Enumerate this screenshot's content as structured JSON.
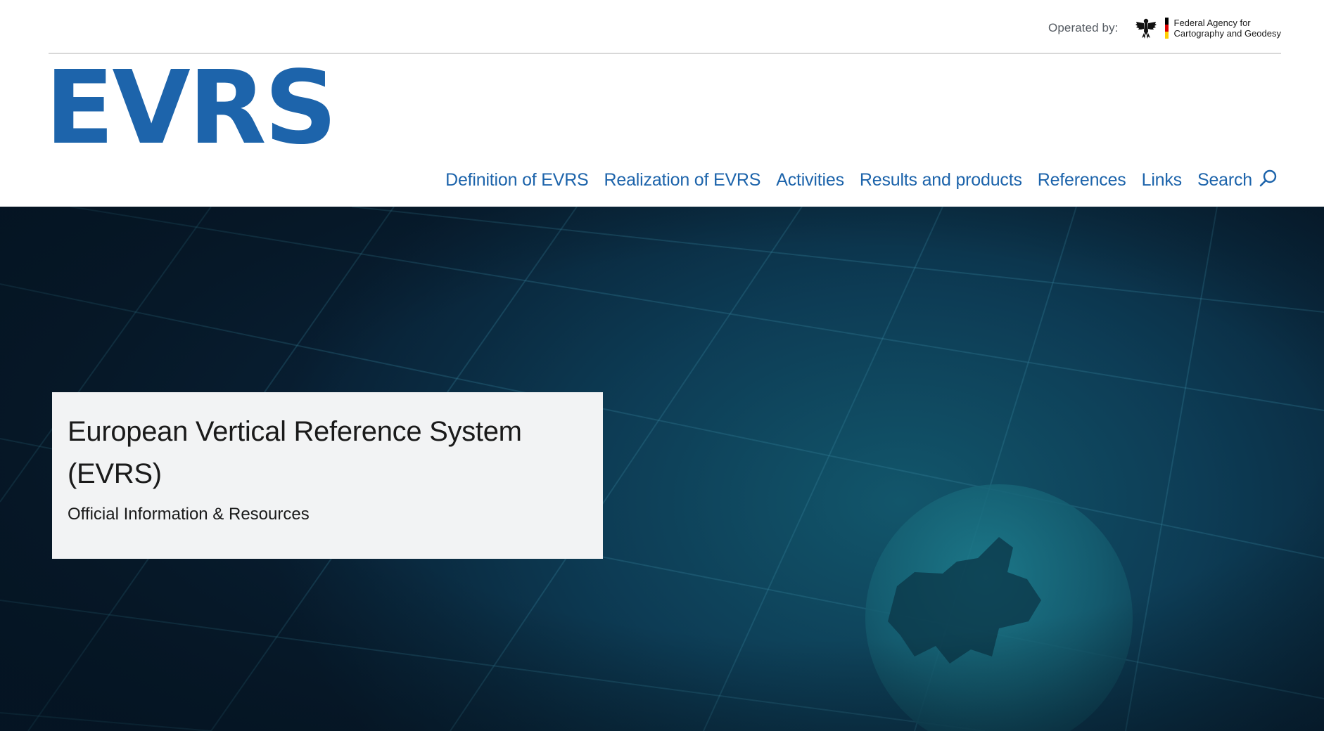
{
  "header": {
    "operated_label": "Operated by:",
    "agency_line1": "Federal Agency for",
    "agency_line2": "Cartography and Geodesy",
    "logo_text": "EVRS",
    "colors": {
      "brand_blue": "#1d64ab",
      "rule": "#d8d8d8"
    }
  },
  "nav": {
    "items": [
      {
        "label": "Definition of EVRS"
      },
      {
        "label": "Realization of EVRS"
      },
      {
        "label": "Activities"
      },
      {
        "label": "Results and products"
      },
      {
        "label": "References"
      },
      {
        "label": "Links"
      }
    ],
    "search_label": "Search",
    "search_icon": "search-icon"
  },
  "hero": {
    "title_line1": "European Vertical Reference System",
    "title_line2": "(EVRS)",
    "subtitle": "Official Information & Resources",
    "image": "globe-europe-grid",
    "colors": {
      "background": "#0d3c55",
      "card": "#f2f3f4"
    }
  }
}
